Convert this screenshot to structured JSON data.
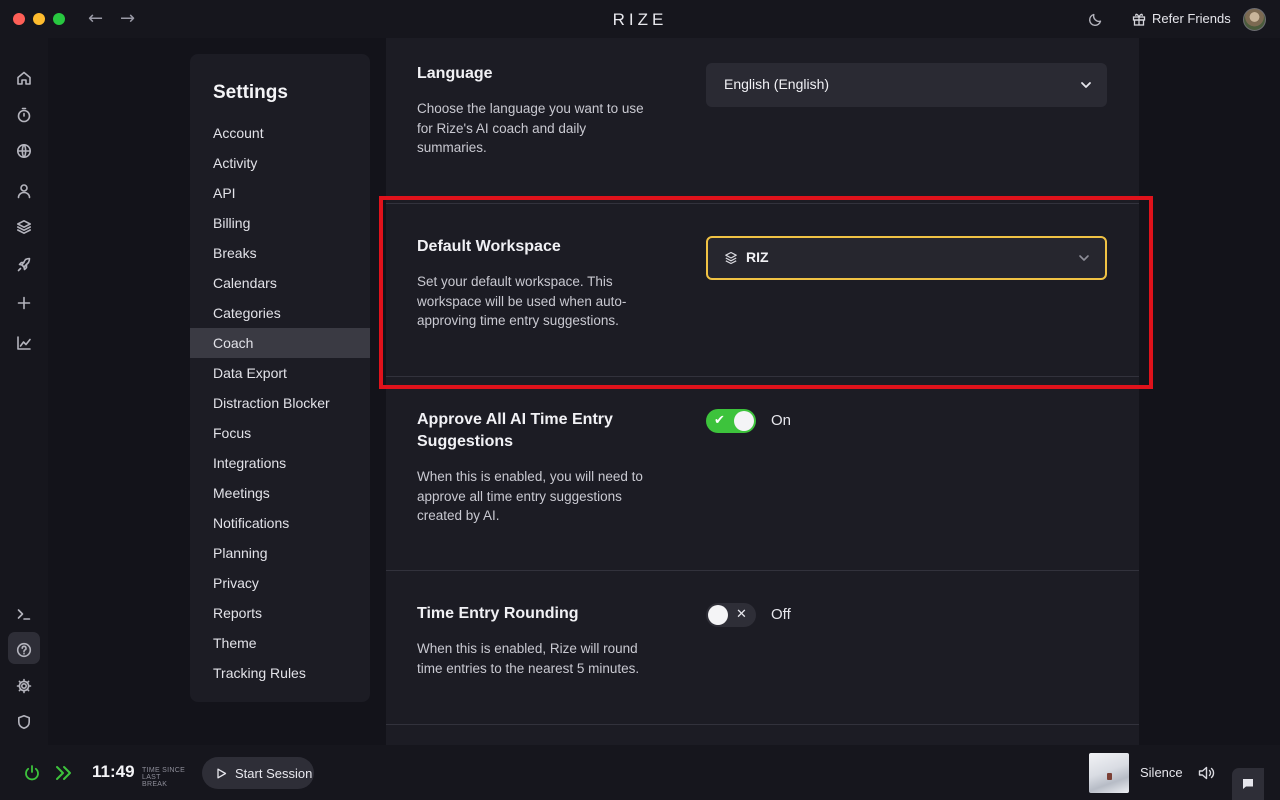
{
  "titlebar": {
    "app_title": "RIZE",
    "back_glyph": "←",
    "forward_glyph": "→",
    "refer_label": "Refer Friends",
    "icons": [
      "moon-icon",
      "gift-icon",
      "avatar"
    ]
  },
  "rail": {
    "items": [
      "home-icon",
      "timer-icon",
      "globe-icon",
      "user-icon",
      "layers-icon",
      "rocket-icon",
      "plus-icon",
      "chart-icon",
      "terminal-icon",
      "help-icon",
      "gear-icon",
      "shield-icon"
    ],
    "active": "gear-icon"
  },
  "settings_nav": {
    "title": "Settings",
    "items": [
      "Account",
      "Activity",
      "API",
      "Billing",
      "Breaks",
      "Calendars",
      "Categories",
      "Coach",
      "Data Export",
      "Distraction Blocker",
      "Focus",
      "Integrations",
      "Meetings",
      "Notifications",
      "Planning",
      "Privacy",
      "Reports",
      "Theme",
      "Tracking Rules"
    ],
    "active": "Coach"
  },
  "sections": {
    "language": {
      "title": "Language",
      "description": "Choose the language you want to use for Rize's AI coach and daily summaries.",
      "value": "English (English)"
    },
    "default_workspace": {
      "title": "Default Workspace",
      "description": "Set your default workspace. This workspace will be used when auto-approving time entry suggestions.",
      "value": "RIZ"
    },
    "approve_ai": {
      "title": "Approve All AI Time Entry Suggestions",
      "description": "When this is enabled, you will need to approve all time entry suggestions created by AI.",
      "state_label": "On",
      "on_glyph": "✔"
    },
    "rounding": {
      "title": "Time Entry Rounding",
      "description": "When this is enabled, Rize will round time entries to the nearest 5 minutes.",
      "state_label": "Off",
      "off_glyph": "✕"
    }
  },
  "bottombar": {
    "time": "11:49",
    "time_caption_1": "TIME SINCE",
    "time_caption_2": "LAST BREAK",
    "start_session_label": "Start Session",
    "sound_label": "Silence"
  },
  "colors": {
    "accent_focus": "#f0c244",
    "toggle_on": "#3dc33c",
    "highlight": "#e0121b",
    "power_green": "#3dc33c"
  }
}
